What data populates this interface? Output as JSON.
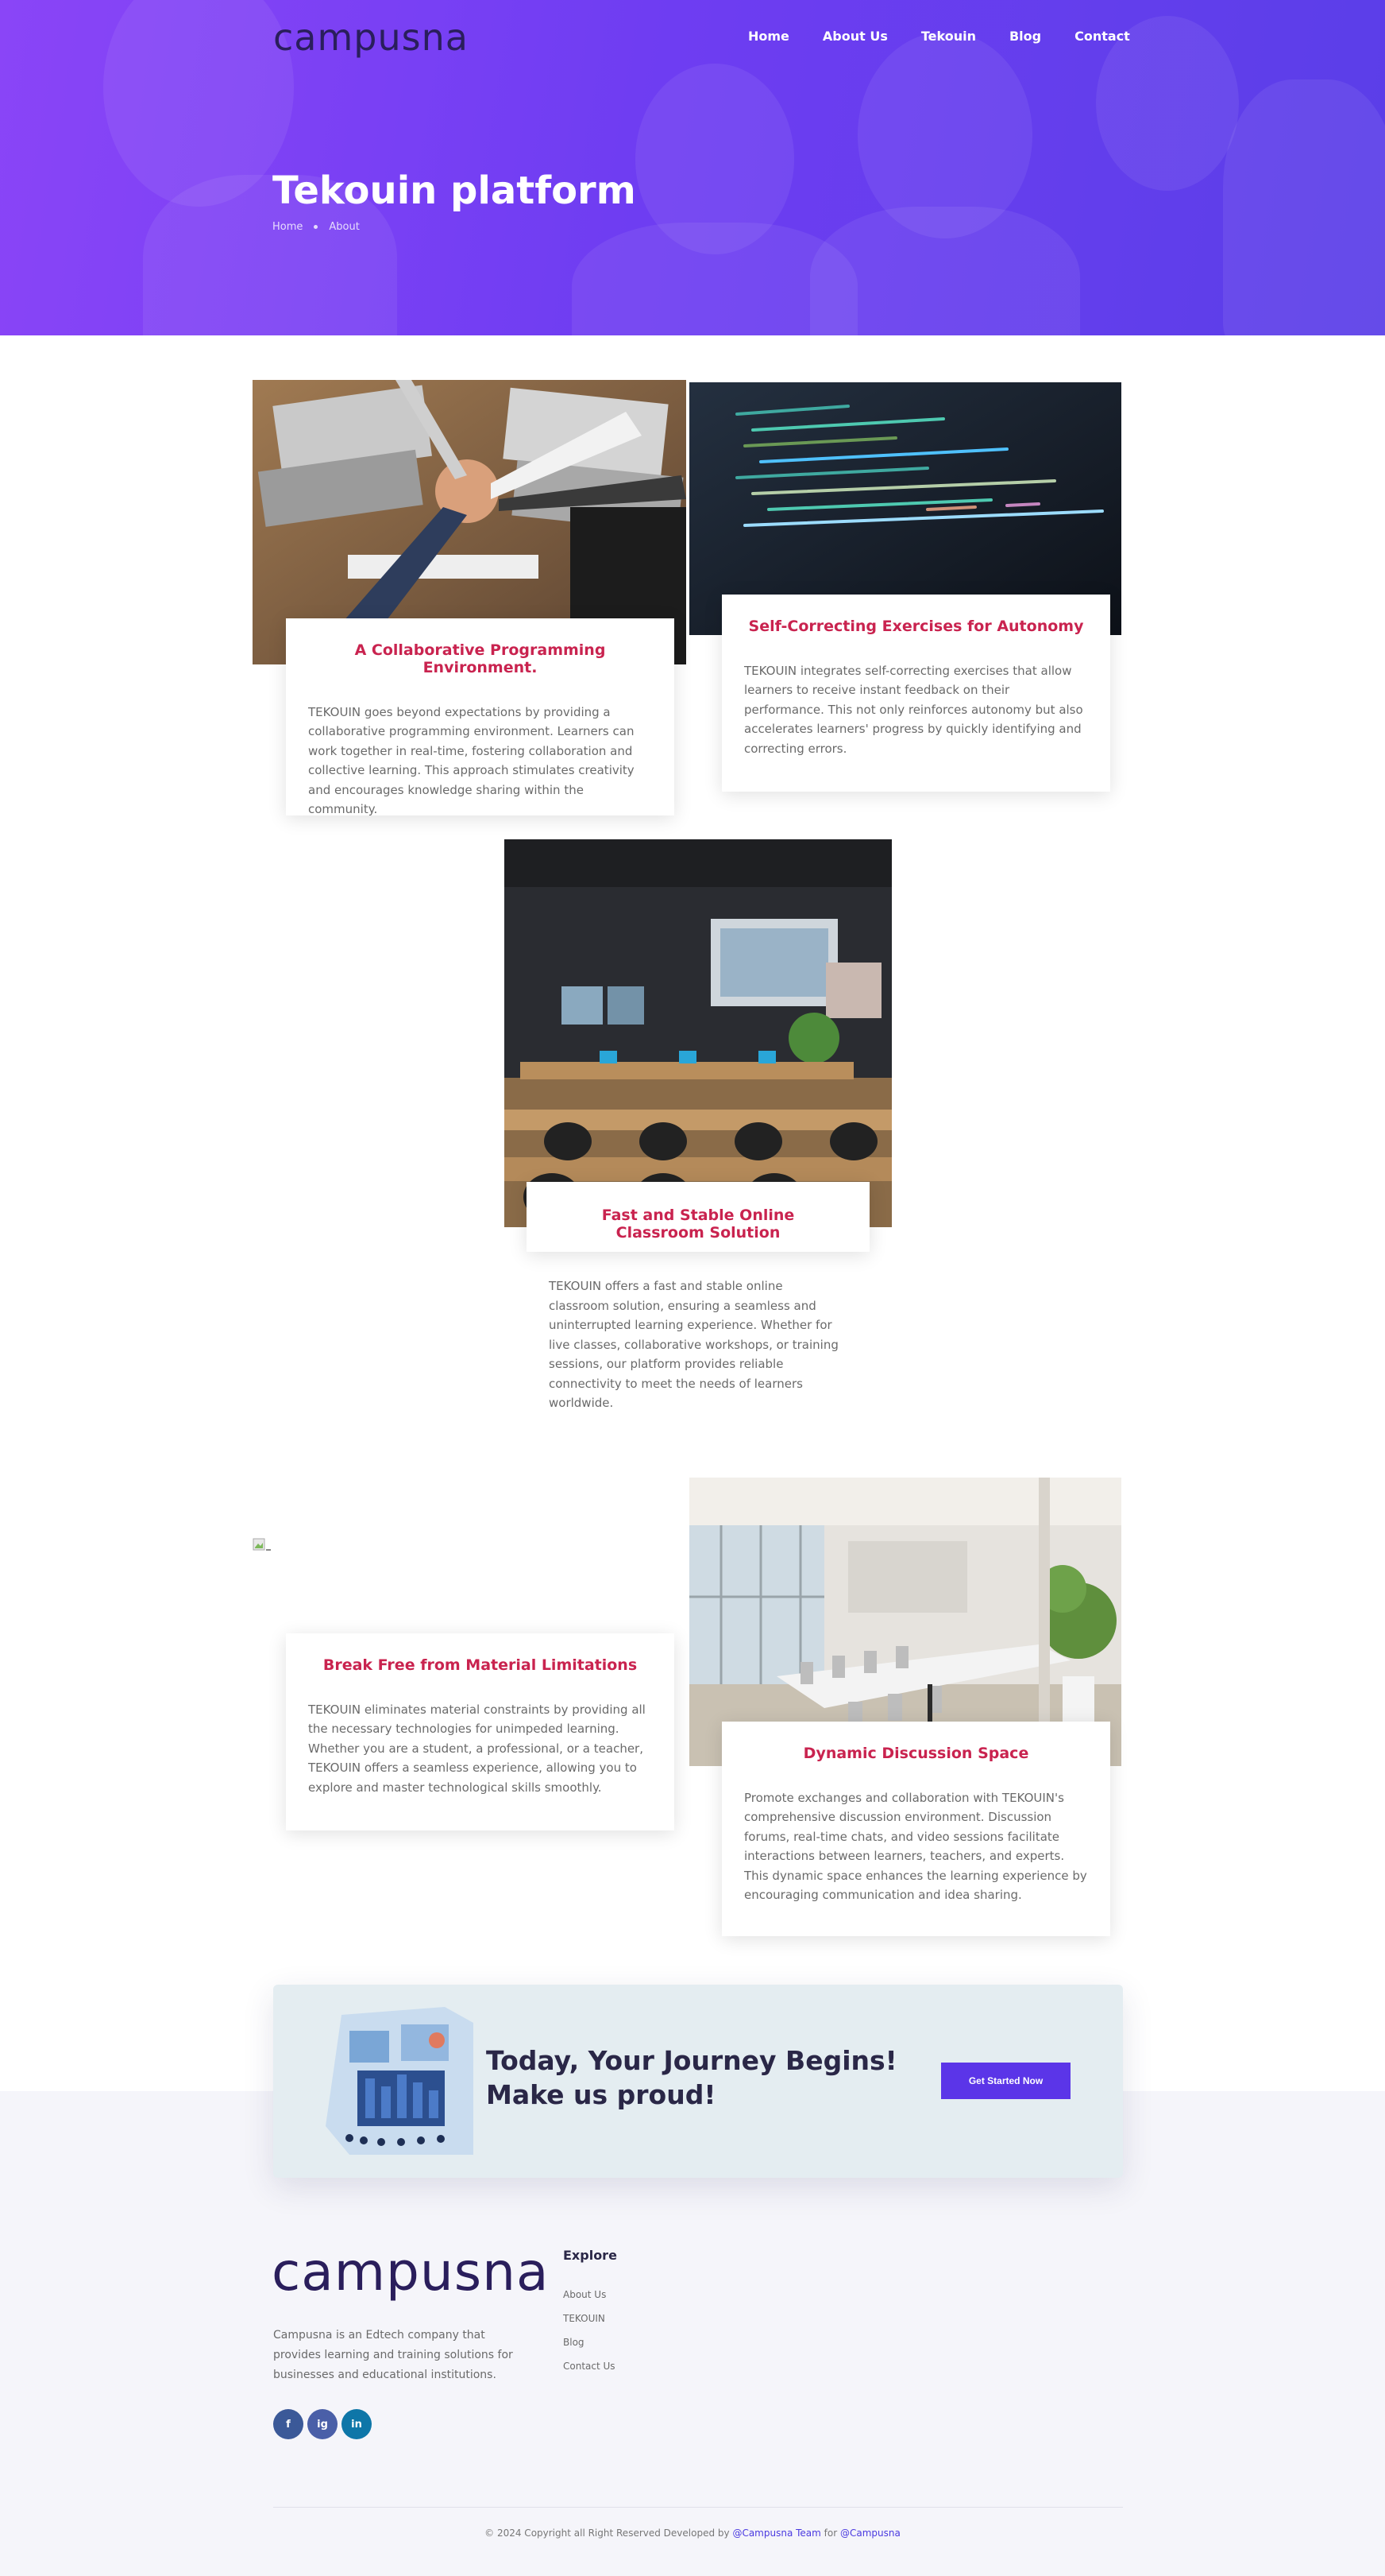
{
  "header": {
    "logo": "campusna",
    "nav": [
      "Home",
      "About Us",
      "Tekouin",
      "Blog",
      "Contact"
    ]
  },
  "hero": {
    "title": "Tekouin platform",
    "breadcrumb": [
      "Home",
      "About"
    ]
  },
  "features": [
    {
      "title": "A Collaborative Programming Environment.",
      "text": "TEKOUIN goes beyond expectations by providing a collaborative programming environment. Learners can work together in real-time, fostering collaboration and collective learning. This approach stimulates creativity and encourages knowledge sharing within the community."
    },
    {
      "title": "Self-Correcting Exercises for Autonomy",
      "text": "TEKOUIN integrates self-correcting exercises that allow learners to receive instant feedback on their performance. This not only reinforces autonomy but also accelerates learners' progress by quickly identifying and correcting errors."
    },
    {
      "title": "Fast and Stable Online Classroom Solution",
      "text": "TEKOUIN offers a fast and stable online classroom solution, ensuring a seamless and uninterrupted learning experience. Whether for live classes, collaborative workshops, or training sessions, our platform provides reliable connectivity to meet the needs of learners worldwide."
    },
    {
      "title": "Break Free from Material Limitations",
      "text": "TEKOUIN eliminates material constraints by providing all the necessary technologies for unimpeded learning. Whether you are a student, a professional, or a teacher, TEKOUIN offers a seamless experience, allowing you to explore and master technological skills smoothly."
    },
    {
      "title": "Dynamic Discussion Space",
      "text": "Promote exchanges and collaboration with TEKOUIN's comprehensive discussion environment. Discussion forums, real-time chats, and video sessions facilitate interactions between learners, teachers, and experts. This dynamic space enhances the learning experience by encouraging communication and idea sharing."
    }
  ],
  "cta": {
    "title_line1": "Today, Your Journey Begins!",
    "title_line2": "Make us proud!",
    "button": "Get Started Now"
  },
  "footer": {
    "logo": "campusna",
    "description": "Campusna is an Edtech company that provides learning and training solutions for businesses and educational institutions.",
    "social": [
      "f",
      "ig",
      "in"
    ],
    "explore_title": "Explore",
    "explore_links": [
      "About Us",
      "TEKOUIN",
      "Blog",
      "Contact Us"
    ],
    "copyright_prefix": "© 2024 Copyright all Right Reserved Developed by",
    "copyright_team": "@Campusna Team",
    "copyright_for": "for",
    "copyright_brand": "@Campusna"
  },
  "colors": {
    "accent": "#5b35e8",
    "feature_title": "#c9234f",
    "dark_text": "#2a2747"
  }
}
